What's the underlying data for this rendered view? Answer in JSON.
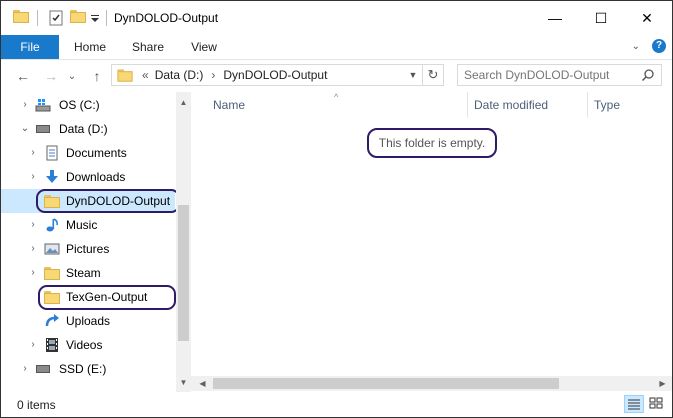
{
  "window": {
    "title": "DynDOLOD-Output",
    "minimize_glyph": "—",
    "maximize_glyph": "☐",
    "close_glyph": "✕"
  },
  "ribbon": {
    "tabs": [
      {
        "label": "File"
      },
      {
        "label": "Home"
      },
      {
        "label": "Share"
      },
      {
        "label": "View"
      }
    ],
    "help_glyph": "?"
  },
  "navigation": {
    "back_glyph": "←",
    "forward_glyph": "→",
    "recent_glyph": "⌄",
    "up_glyph": "↑",
    "overflow_glyph": "«",
    "breadcrumb": [
      "Data (D:)",
      "DynDOLOD-Output"
    ],
    "chevron_glyph": "›",
    "refresh_glyph": "↻"
  },
  "search": {
    "placeholder": "Search DynDOLOD-Output"
  },
  "tree": [
    {
      "label": "OS (C:)",
      "icon": "drive-windows-icon",
      "level": 1,
      "expander": "›"
    },
    {
      "label": "Data (D:)",
      "icon": "drive-icon",
      "level": 1,
      "expander": "⌄"
    },
    {
      "label": "Documents",
      "icon": "documents-icon",
      "level": 2,
      "expander": "›"
    },
    {
      "label": "Downloads",
      "icon": "downloads-icon",
      "level": 2,
      "expander": "›"
    },
    {
      "label": "DynDOLOD-Output",
      "icon": "folder-icon",
      "level": 2,
      "expander": "",
      "selected": true
    },
    {
      "label": "Music",
      "icon": "music-icon",
      "level": 2,
      "expander": "›"
    },
    {
      "label": "Pictures",
      "icon": "pictures-icon",
      "level": 2,
      "expander": "›"
    },
    {
      "label": "Steam",
      "icon": "folder-icon",
      "level": 2,
      "expander": "›"
    },
    {
      "label": "TexGen-Output",
      "icon": "folder-icon",
      "level": 2,
      "expander": ""
    },
    {
      "label": "Uploads",
      "icon": "uploads-icon",
      "level": 2,
      "expander": ""
    },
    {
      "label": "Videos",
      "icon": "videos-icon",
      "level": 2,
      "expander": "›"
    },
    {
      "label": "SSD (E:)",
      "icon": "drive-icon",
      "level": 1,
      "expander": "›"
    }
  ],
  "columns": [
    {
      "label": "Name"
    },
    {
      "label": "Date modified"
    },
    {
      "label": "Type"
    }
  ],
  "content": {
    "empty_message": "This folder is empty."
  },
  "status": {
    "items_text": "0 items"
  },
  "colors": {
    "accent": "#1979ca",
    "selection": "#cce8ff",
    "highlight_outline": "#2e1a66",
    "folder": "#f8d775"
  }
}
